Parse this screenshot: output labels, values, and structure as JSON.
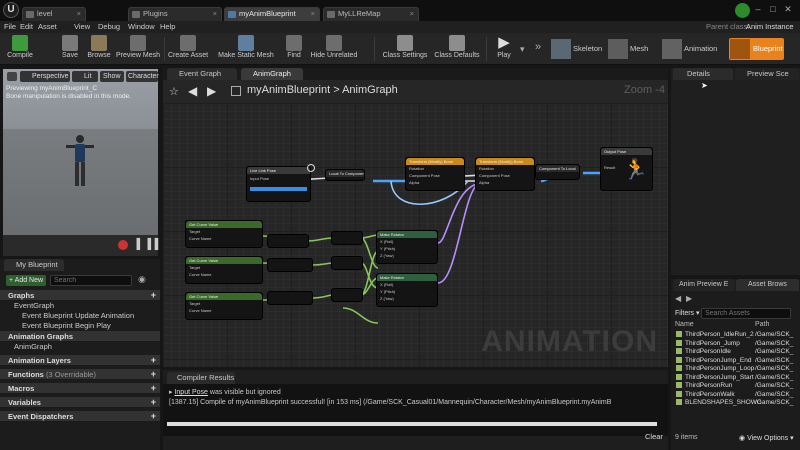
{
  "title_tabs": [
    "level",
    "Plugins",
    "myAnimBlueprint",
    "MyLLReMap"
  ],
  "menu": [
    "File",
    "Edit",
    "Asset",
    "View",
    "Debug",
    "Window",
    "Help"
  ],
  "parent_class_label": "Parent class:",
  "parent_class_value": "Anim Instance",
  "toolbar": [
    "Compile",
    "Save",
    "Browse",
    "Preview Mesh",
    "Create Asset",
    "Make Static Mesh",
    "Find",
    "Hide Unrelated",
    "Class Settings",
    "Class Defaults",
    "Play"
  ],
  "modes": [
    "Skeleton",
    "Mesh",
    "Animation",
    "Blueprint"
  ],
  "viewport": {
    "buttons": [
      "Perspective",
      "Lit",
      "Show",
      "Character"
    ],
    "info_line1": "Previewing myAnimBlueprint_C",
    "info_line2": "Bone manipulation is disabled in this mode."
  },
  "my_blueprint": {
    "title": "My Blueprint",
    "add_new": "Add New",
    "search_placeholder": "Search",
    "graphs_head": "Graphs",
    "graphs": [
      "EventGraph",
      "Event Blueprint Update Animation",
      "Event Blueprint Begin Play"
    ],
    "anim_graphs_head": "Animation Graphs",
    "anim_graphs": [
      "AnimGraph"
    ],
    "anim_layers": "Animation Layers",
    "functions": "Functions",
    "functions_count": "(3 Overridable)",
    "macros": "Macros",
    "variables": "Variables",
    "dispatchers": "Event Dispatchers"
  },
  "graph_tabs": [
    "Event Graph",
    "AnimGraph"
  ],
  "breadcrumb": {
    "root": "myAnimBlueprint",
    "sep": ">",
    "current": "AnimGraph"
  },
  "zoom": "Zoom -4",
  "watermark": "ANIMATION",
  "nodes": {
    "local_pose": "Live Link Pose",
    "input_pose": "Input Pose",
    "to_component": "Local To Component",
    "transform_a": "Transform (Modify) Bone",
    "transform_b": "Transform (Modify) Bone",
    "component_to_local": "Component To Local",
    "output_pose": "Output Pose",
    "result": "Result",
    "get_curve_1": "Get Curve Value",
    "get_curve_2": "Get Curve Value",
    "get_curve_3": "Get Curve Value",
    "make_rotator_1": "Make Rotator",
    "make_rotator_2": "Make Rotator",
    "return_value": "Return Value",
    "target": "Target",
    "curve_name": "Curve Name",
    "component_pose": "Component Pose",
    "rotation": "Rotation",
    "alpha": "Alpha",
    "x_roll": "X (Roll)",
    "y_pitch": "Y (Pitch)",
    "z_yaw": "Z (Yaw)"
  },
  "compiler": {
    "title": "Compiler Results",
    "line1_link": "Input Pose",
    "line1_rest": "was visible but ignored",
    "line2": "[1387.15] Compile of myAnimBlueprint successful! [in 153 ms] (/Game/SCK_Casual01/Mannequin/Character/Mesh/myAnimBlueprint.myAnimB",
    "clear": "Clear"
  },
  "details_tab": "Details",
  "preview_tab": "Preview Sce",
  "asset_tabs": [
    "Anim Preview E",
    "Asset Brows"
  ],
  "asset_browser": {
    "filters": "Filters",
    "search_placeholder": "Search Assets",
    "col_name": "Name",
    "col_path": "Path",
    "items": [
      {
        "name": "ThirdPerson_IdleRun_2",
        "path": "/Game/SCK_"
      },
      {
        "name": "ThirdPerson_Jump",
        "path": "/Game/SCK_"
      },
      {
        "name": "ThirdPersonIdle",
        "path": "/Game/SCK_"
      },
      {
        "name": "ThirdPersonJump_End",
        "path": "/Game/SCK_"
      },
      {
        "name": "ThirdPersonJump_Loop",
        "path": "/Game/SCK_"
      },
      {
        "name": "ThirdPersonJump_Start",
        "path": "/Game/SCK_"
      },
      {
        "name": "ThirdPersonRun",
        "path": "/Game/SCK_"
      },
      {
        "name": "ThirdPersonWalk",
        "path": "/Game/SCK_"
      },
      {
        "name": "BLENDSHAPES_SHOWC",
        "path": "/Game/SCK_"
      }
    ],
    "count": "9 items",
    "view_options": "View Options"
  },
  "colors": {
    "accent_orange": "#e8821c",
    "compile_green": "#3d9b3d",
    "pose_blue": "#4aa3ff"
  }
}
